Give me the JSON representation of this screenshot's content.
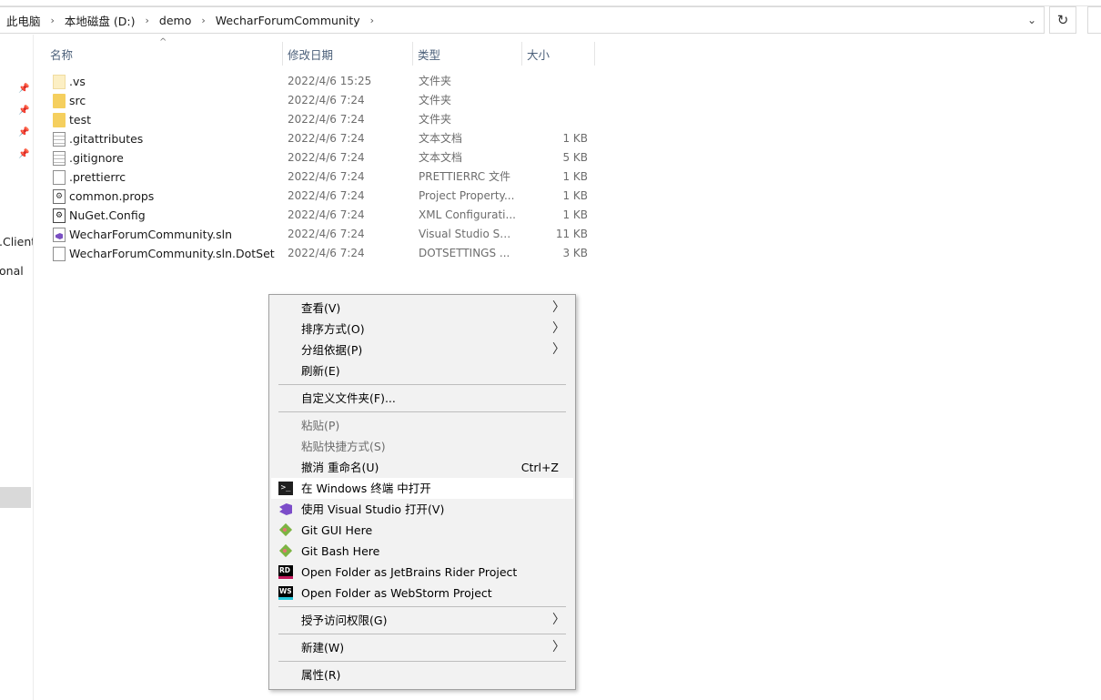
{
  "breadcrumb": [
    "此电脑",
    "本地磁盘 (D:)",
    "demo",
    "WecharForumCommunity"
  ],
  "nav": {
    "partial_items": [
      ".Client",
      "onal"
    ]
  },
  "columns": {
    "name": "名称",
    "date": "修改日期",
    "type": "类型",
    "size": "大小"
  },
  "files": [
    {
      "name": ".vs",
      "date": "2022/4/6 15:25",
      "type": "文件夹",
      "size": "",
      "icon": "folder-hidden-icon"
    },
    {
      "name": "src",
      "date": "2022/4/6 7:24",
      "type": "文件夹",
      "size": "",
      "icon": "folder-icon"
    },
    {
      "name": "test",
      "date": "2022/4/6 7:24",
      "type": "文件夹",
      "size": "",
      "icon": "folder-icon"
    },
    {
      "name": ".gitattributes",
      "date": "2022/4/6 7:24",
      "type": "文本文档",
      "size": "1 KB",
      "icon": "text-file-icon"
    },
    {
      "name": ".gitignore",
      "date": "2022/4/6 7:24",
      "type": "文本文档",
      "size": "5 KB",
      "icon": "text-file-icon"
    },
    {
      "name": ".prettierrc",
      "date": "2022/4/6 7:24",
      "type": "PRETTIERRC 文件",
      "size": "1 KB",
      "icon": "blank-file-icon"
    },
    {
      "name": "common.props",
      "date": "2022/4/6 7:24",
      "type": "Project Property...",
      "size": "1 KB",
      "icon": "props-file-icon"
    },
    {
      "name": "NuGet.Config",
      "date": "2022/4/6 7:24",
      "type": "XML Configurati...",
      "size": "1 KB",
      "icon": "config-file-icon"
    },
    {
      "name": "WecharForumCommunity.sln",
      "date": "2022/4/6 7:24",
      "type": "Visual Studio Sol...",
      "size": "11 KB",
      "icon": "sln-file-icon"
    },
    {
      "name": "WecharForumCommunity.sln.DotSetti...",
      "date": "2022/4/6 7:24",
      "type": "DOTSETTINGS ...",
      "size": "3 KB",
      "icon": "blank-file-icon"
    }
  ],
  "context_menu": {
    "view": "查看(V)",
    "sort": "排序方式(O)",
    "group": "分组依据(P)",
    "refresh": "刷新(E)",
    "customize": "自定义文件夹(F)...",
    "paste": "粘贴(P)",
    "paste_shortcut": "粘贴快捷方式(S)",
    "undo_rename": "撤消 重命名(U)",
    "undo_shortcut": "Ctrl+Z",
    "open_terminal": "在 Windows 终端 中打开",
    "open_vs": "使用 Visual Studio 打开(V)",
    "git_gui": "Git GUI Here",
    "git_bash": "Git Bash Here",
    "rider": "Open Folder as JetBrains Rider Project",
    "webstorm": "Open Folder as WebStorm Project",
    "grant_access": "授予访问权限(G)",
    "new": "新建(W)",
    "properties": "属性(R)",
    "rider_icon_text": "RD",
    "webstorm_icon_text": "WS"
  }
}
